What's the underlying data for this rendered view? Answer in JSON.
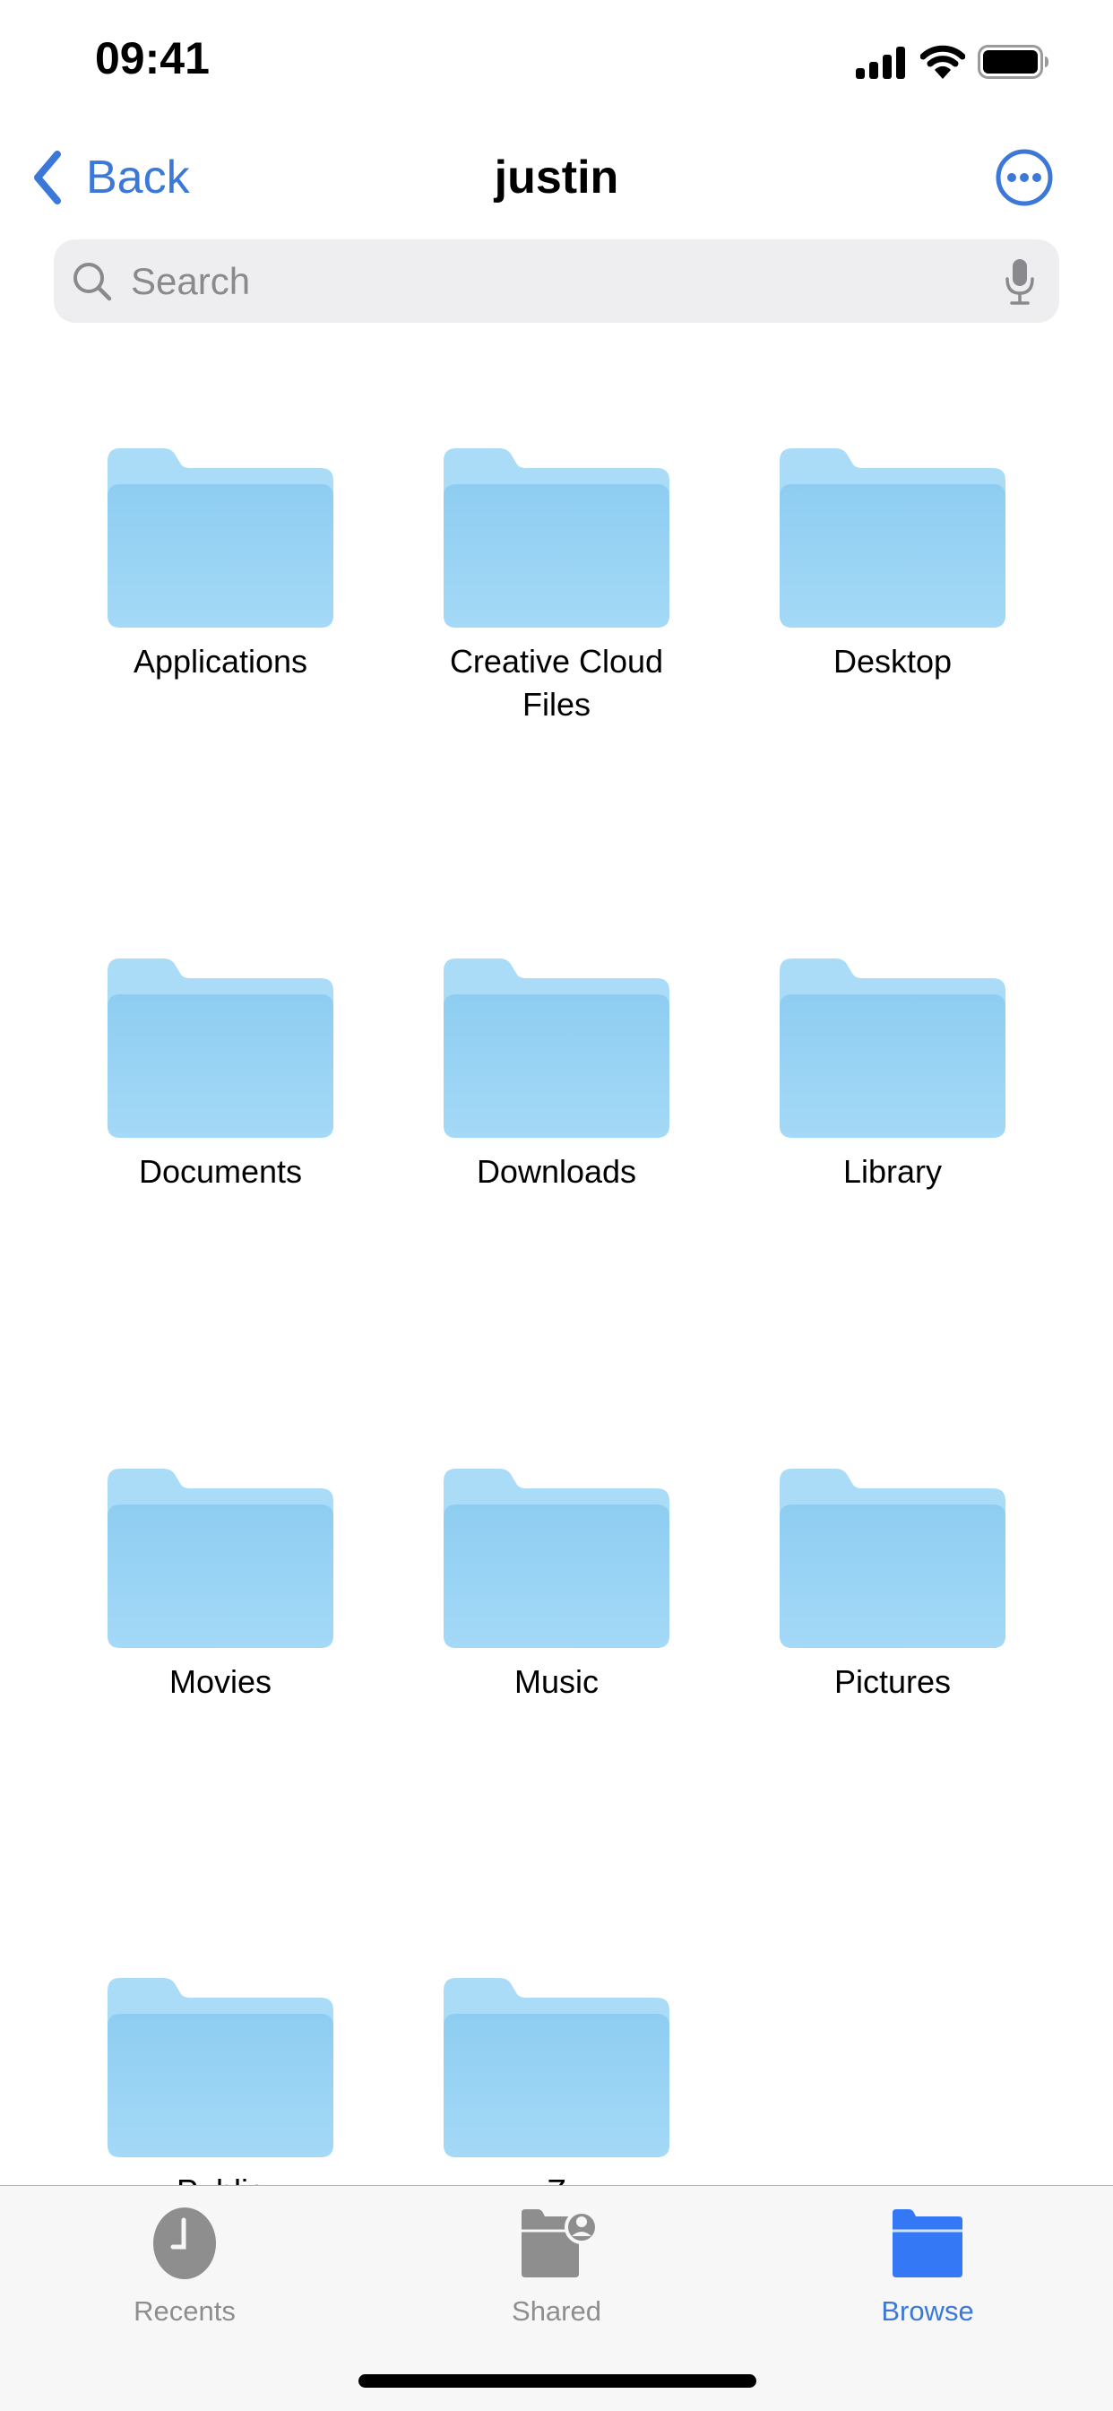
{
  "status_bar": {
    "time": "09:41",
    "icons": [
      "cellular-signal-icon",
      "wifi-icon",
      "battery-icon"
    ]
  },
  "nav": {
    "back_label": "Back",
    "title": "justin",
    "more_icon": "ellipsis-circle-icon"
  },
  "search": {
    "placeholder": "Search",
    "value": ""
  },
  "colors": {
    "accent": "#3b78d8",
    "folder_back": "#aadcf8",
    "folder_front_top": "#8ecdf1",
    "folder_front_bottom": "#a4d9f7",
    "tab_inactive": "#8e8e8e",
    "tab_active_icon": "#3478f6"
  },
  "folders": [
    {
      "label": "Applications"
    },
    {
      "label": "Creative Cloud Files"
    },
    {
      "label": "Desktop"
    },
    {
      "label": "Documents"
    },
    {
      "label": "Downloads"
    },
    {
      "label": "Library"
    },
    {
      "label": "Movies"
    },
    {
      "label": "Music"
    },
    {
      "label": "Pictures"
    },
    {
      "label": "Public"
    },
    {
      "label": "Z"
    }
  ],
  "tabbar": {
    "tabs": [
      {
        "label": "Recents",
        "icon": "clock-icon",
        "active": false
      },
      {
        "label": "Shared",
        "icon": "shared-folder-icon",
        "active": false
      },
      {
        "label": "Browse",
        "icon": "folder-icon",
        "active": true
      }
    ]
  }
}
